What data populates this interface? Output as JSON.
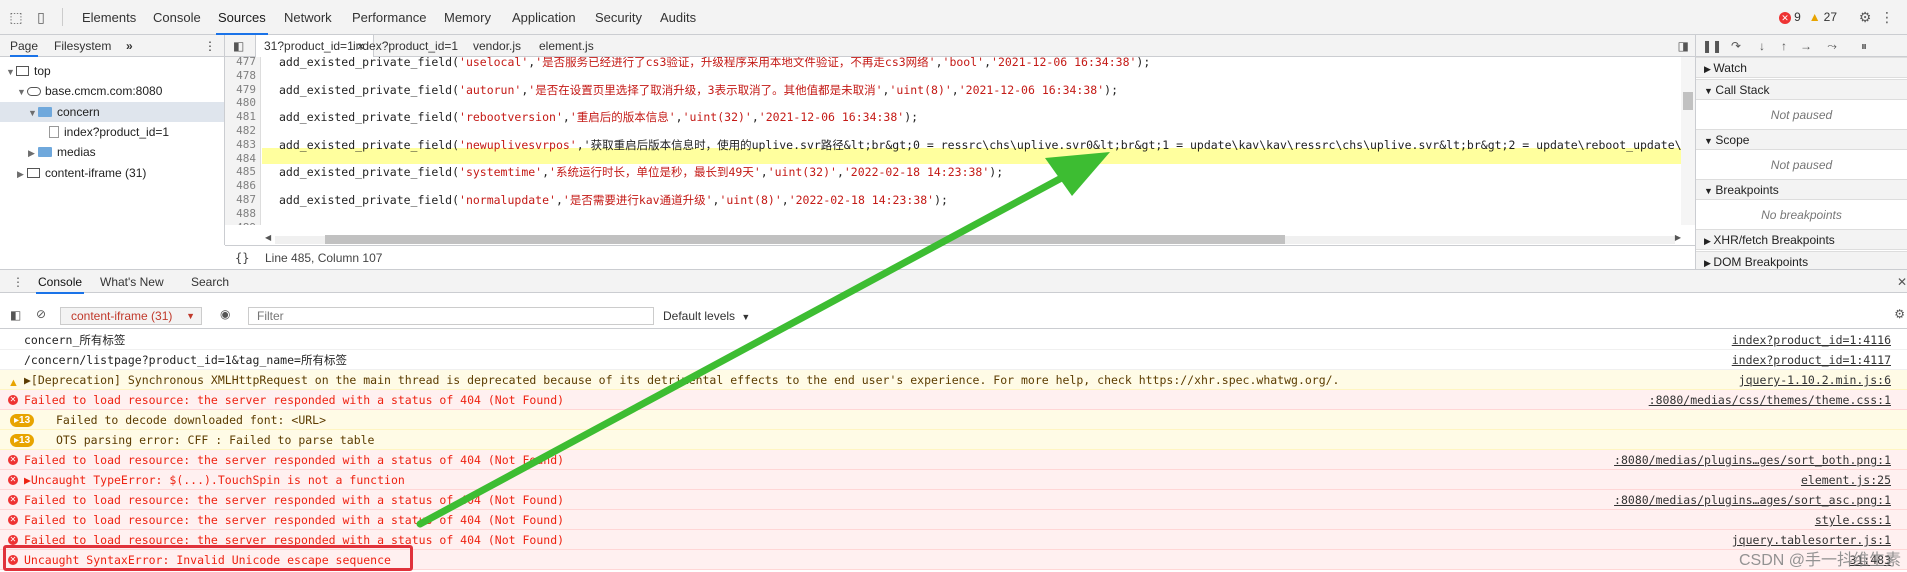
{
  "topbar": {
    "tabs": [
      "Elements",
      "Console",
      "Sources",
      "Network",
      "Performance",
      "Memory",
      "Application",
      "Security",
      "Audits"
    ],
    "active_tab": "Sources",
    "error_count": "9",
    "warning_count": "27"
  },
  "navigator": {
    "tabs": [
      "Page",
      "Filesystem"
    ],
    "more": "»",
    "tree": [
      {
        "label": "top",
        "indent": 0,
        "twisty": "▼",
        "icon": "frame",
        "selected": false
      },
      {
        "label": "base.cmcm.com:8080",
        "indent": 1,
        "twisty": "▼",
        "icon": "cloud",
        "selected": false
      },
      {
        "label": "concern",
        "indent": 2,
        "twisty": "▼",
        "icon": "folder",
        "selected": true
      },
      {
        "label": "index?product_id=1",
        "indent": 3,
        "twisty": "",
        "icon": "file",
        "selected": false
      },
      {
        "label": "medias",
        "indent": 2,
        "twisty": "▶",
        "icon": "folder",
        "selected": false
      },
      {
        "label": "content-iframe (31)",
        "indent": 1,
        "twisty": "▶",
        "icon": "frame",
        "selected": false
      }
    ]
  },
  "editor": {
    "tabs": [
      {
        "label": "31?product_id=1",
        "active": true,
        "closable": true
      },
      {
        "label": "index?product_id=1",
        "active": false,
        "closable": false
      },
      {
        "label": "vendor.js",
        "active": false,
        "closable": false
      },
      {
        "label": "element.js",
        "active": false,
        "closable": false
      }
    ],
    "lines": [
      {
        "n": "477",
        "code": "add_existed_private_field('uselocal','是否服务已经进行了cs3验证，升级程序采用本地文件验证，不再走cs3网络','bool','2021-12-06 16:34:38');"
      },
      {
        "n": "478",
        "code": ""
      },
      {
        "n": "479",
        "code": "add_existed_private_field('autorun','是否在设置页里选择了取消升级，3表示取消了。其他值都是未取消','uint(8)','2021-12-06 16:34:38');"
      },
      {
        "n": "480",
        "code": ""
      },
      {
        "n": "481",
        "code": "add_existed_private_field('rebootversion','重启后的版本信息','uint(32)','2021-12-06 16:34:38');"
      },
      {
        "n": "482",
        "code": ""
      },
      {
        "n": "483",
        "code": "add_existed_private_field('newuplivesvrpos','获取重启后版本信息时，使用的uplive.svr路径&lt;br&gt;0 = ressrc\\chs\\uplive.svr0&lt;br&gt;1 = update\\kav\\kav\\ressrc\\chs\\uplive.svr&lt;br&gt;2 = update\\reboot_update\\ressrc",
        "highlight": true
      },
      {
        "n": "484",
        "code": ""
      },
      {
        "n": "485",
        "code": "add_existed_private_field('systemtime','系统运行时长，单位是秒，最长到49天','uint(32)','2022-02-18 14:23:38');"
      },
      {
        "n": "486",
        "code": ""
      },
      {
        "n": "487",
        "code": "add_existed_private_field('normalupdate','是否需要进行kav通道升级','uint(8)','2022-02-18 14:23:38');"
      },
      {
        "n": "488",
        "code": ""
      },
      {
        "n": "489",
        "code": ""
      }
    ],
    "status": "Line 485, Column 107",
    "braces": "{}"
  },
  "debugger": {
    "sections": [
      {
        "title": "Watch",
        "body": ""
      },
      {
        "title": "Call Stack",
        "body": "Not paused"
      },
      {
        "title": "Scope",
        "body": "Not paused"
      },
      {
        "title": "Breakpoints",
        "body": "No breakpoints"
      },
      {
        "title": "XHR/fetch Breakpoints",
        "body": ""
      },
      {
        "title": "DOM Breakpoints",
        "body": ""
      }
    ]
  },
  "drawer": {
    "tabs": [
      "Console",
      "What's New",
      "Search"
    ],
    "active_tab": "Console",
    "context": "content-iframe (31)",
    "filter_placeholder": "Filter",
    "levels": "Default levels"
  },
  "console": {
    "messages": [
      {
        "level": "plain",
        "text": "concern_所有标签",
        "source": "index?product_id=1:4116"
      },
      {
        "level": "plain",
        "text": "/concern/listpage?product_id=1&tag_name=所有标签",
        "source": "index?product_id=1:4117"
      },
      {
        "level": "warn",
        "text": "▶[Deprecation] Synchronous XMLHttpRequest on the main thread is deprecated because of its detrimental effects to the end user's experience. For more help, check https://xhr.spec.whatwg.org/.",
        "source": "jquery-1.10.2.min.js:6"
      },
      {
        "level": "err",
        "text": "Failed to load resource: the server responded with a status of 404 (Not Found)",
        "source": ":8080/medias/css/themes/theme.css:1"
      },
      {
        "level": "warnbadge",
        "badge": "▸13",
        "text": "Failed to decode downloaded font: <URL>",
        "source": ""
      },
      {
        "level": "warnbadge",
        "badge": "▸13",
        "text": "OTS parsing error: CFF : Failed to parse table",
        "source": ""
      },
      {
        "level": "err",
        "text": "Failed to load resource: the server responded with a status of 404 (Not Found)",
        "source": ":8080/medias/plugins…ges/sort_both.png:1"
      },
      {
        "level": "err",
        "text": "▶Uncaught TypeError: $(...).TouchSpin is not a function",
        "source": "element.js:25"
      },
      {
        "level": "err",
        "text": "Failed to load resource: the server responded with a status of 404 (Not Found)",
        "source": ":8080/medias/plugins…ages/sort_asc.png:1"
      },
      {
        "level": "err",
        "text": "Failed to load resource: the server responded with a status of 404 (Not Found)",
        "source": "style.css:1"
      },
      {
        "level": "err",
        "text": "Failed to load resource: the server responded with a status of 404 (Not Found)",
        "source": "jquery.tablesorter.js:1"
      },
      {
        "level": "err",
        "text": "Uncaught SyntaxError: Invalid Unicode escape sequence",
        "source": "31:483"
      }
    ]
  },
  "watermark": "CSDN @手一抖维生素",
  "colors": {
    "error_red": "#e21",
    "warning_amber": "#e8a400",
    "annotation_box": "#e0323b",
    "arrow_green": "#3dbd32",
    "highlight_line": "#ffff9e"
  }
}
